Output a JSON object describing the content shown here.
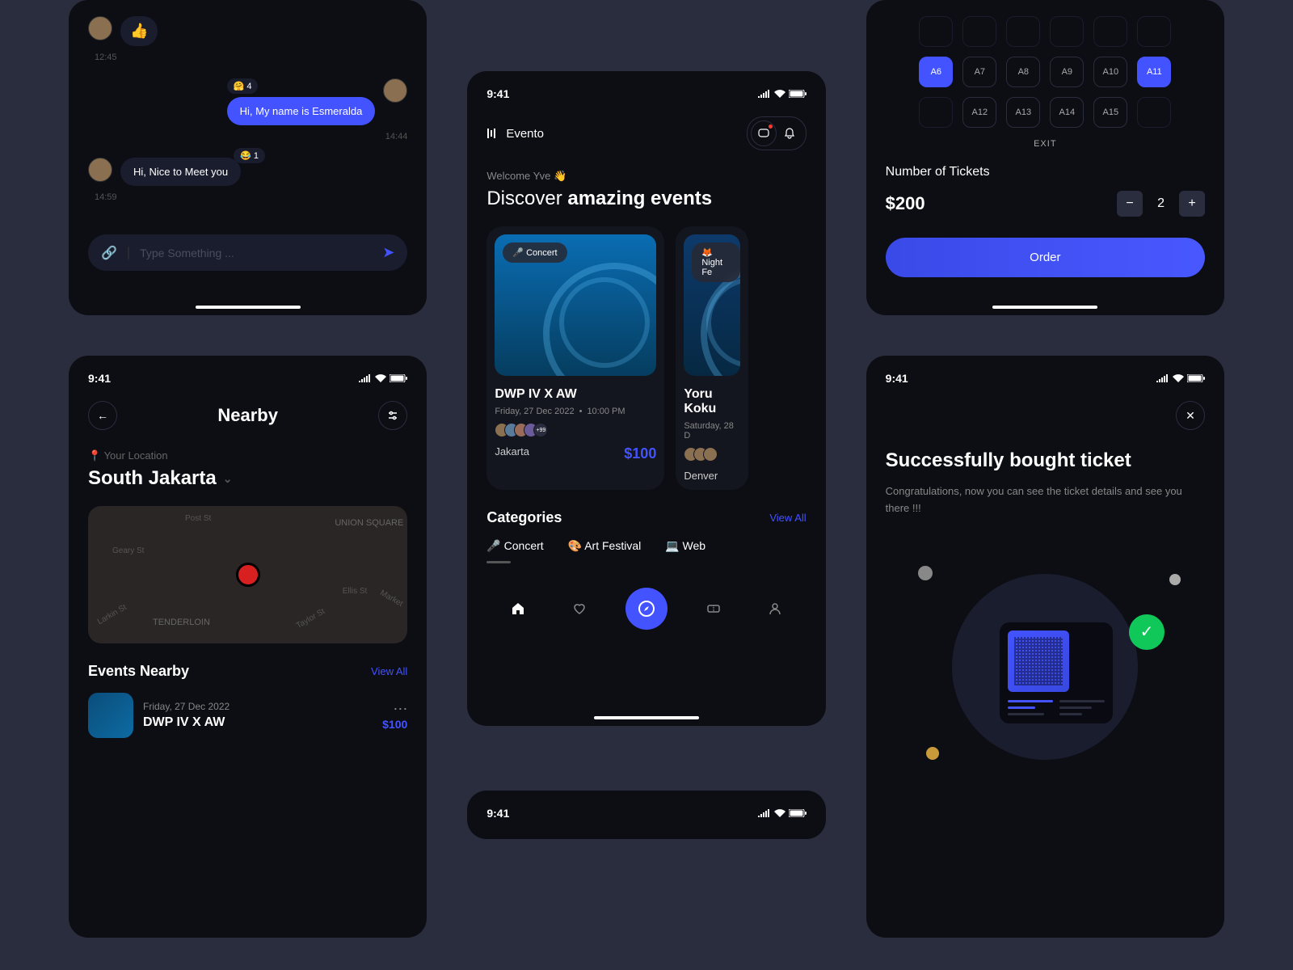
{
  "chat": {
    "msg1_time": "12:45",
    "msg2_text": "Hi, My name is Esmeralda",
    "msg2_reactions": "🤗 4",
    "msg2_time": "14:44",
    "msg3_text": "Hi, Nice to Meet you",
    "msg3_reactions": "😂 1",
    "msg3_time": "14:59",
    "thumbs": "👍",
    "input_placeholder": "Type Something ...",
    "link_icon": "🔗"
  },
  "nearby": {
    "time": "9:41",
    "title": "Nearby",
    "location_label": "📍 Your Location",
    "location": "South Jakarta",
    "streets": {
      "s1": "Post St",
      "s2": "Geary St",
      "s3": "Ellis St",
      "s4": "Larkin St",
      "s5": "TENDERLOIN",
      "s6": "UNION SQUARE",
      "s7": "Taylor St",
      "s8": "Market"
    },
    "events_title": "Events Nearby",
    "view_all": "View All",
    "event1_date": "Friday, 27 Dec 2022",
    "event1_name": "DWP IV X AW",
    "event1_price": "$100"
  },
  "discover": {
    "time": "9:41",
    "brand": "Evento",
    "welcome": "Welcome Yve 👋",
    "title_1": "Discover ",
    "title_2": "amazing events",
    "card1_tag": "🎤 Concert",
    "card1_title": "DWP IV X AW",
    "card1_date": "Friday, 27 Dec 2022",
    "card1_time": "10:00 PM",
    "card1_loc": "Jakarta",
    "card1_price": "$100",
    "card1_more": "+99",
    "card2_tag": "🦊 Night Fe",
    "card2_title": "Yoru Koku",
    "card2_date": "Saturday, 28 D",
    "card2_loc": "Denver",
    "categories_title": "Categories",
    "view_all": "View All",
    "cat1": "🎤 Concert",
    "cat2": "🎨 Art Festival",
    "cat3": "💻 Web"
  },
  "peek": {
    "time": "9:41"
  },
  "seats": {
    "row1": [
      "A6",
      "A7",
      "A8",
      "A9",
      "A10",
      "A11"
    ],
    "row2": [
      "",
      "A12",
      "A13",
      "A14",
      "A15",
      ""
    ],
    "selected": [
      "A6",
      "A11"
    ],
    "exit": "EXIT",
    "ticket_label": "Number of Tickets",
    "price": "$200",
    "qty": "2",
    "order": "Order"
  },
  "success": {
    "time": "9:41",
    "title": "Successfully bought ticket",
    "text": "Congratulations, now you can see the ticket details and see you there !!!"
  }
}
